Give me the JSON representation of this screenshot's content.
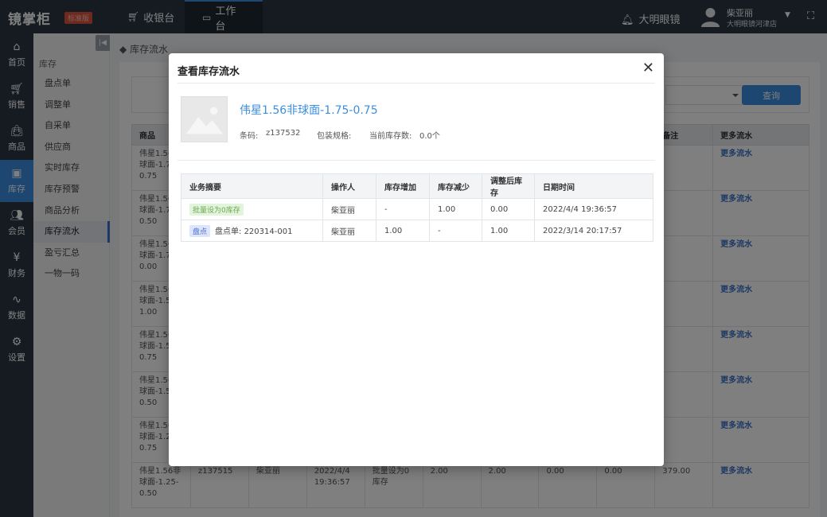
{
  "topbar": {
    "logo": "镜掌柜",
    "edition": "标准版",
    "nav": [
      {
        "label": "收银台",
        "icon": "cart-icon"
      },
      {
        "label": "工作台",
        "icon": "monitor-icon"
      }
    ],
    "store": "大明眼镜",
    "user_name": "柴亚丽",
    "user_store": "大明眼镜河津店"
  },
  "rail": {
    "items": [
      {
        "label": "首页",
        "icon": "home-icon"
      },
      {
        "label": "销售",
        "icon": "cart-icon"
      },
      {
        "label": "商品",
        "icon": "bag-icon"
      },
      {
        "label": "库存",
        "icon": "box-icon",
        "active": true
      },
      {
        "label": "会员",
        "icon": "members-icon"
      },
      {
        "label": "财务",
        "icon": "yen-icon"
      },
      {
        "label": "数据",
        "icon": "pulse-icon"
      },
      {
        "label": "设置",
        "icon": "gear-icon"
      }
    ]
  },
  "submenu": {
    "title": "库存",
    "items": [
      "盘点单",
      "调整单",
      "自采单",
      "供应商",
      "实时库存",
      "库存预警",
      "商品分析",
      "库存流水",
      "盈亏汇总",
      "一物一码"
    ],
    "active_index": 7
  },
  "page": {
    "breadcrumb": "库存流水",
    "query_label": "查询",
    "headers": [
      "商品",
      "",
      "",
      "",
      "",
      "",
      "",
      "",
      "",
      "备注",
      "更多流水"
    ],
    "more_label": "更多流水",
    "rows": [
      {
        "product": "伟星1.56非球面-1.75-0.75"
      },
      {
        "product": "伟星1.56非球面-1.75-0.50"
      },
      {
        "product": "伟星1.56非球面-1.75-0.00"
      },
      {
        "product": "伟星1.56非球面-1.50-1.00"
      },
      {
        "product": "伟星1.56非球面-1.50-0.75"
      },
      {
        "product": "伟星1.56非球面-1.50-0.50"
      },
      {
        "product": "伟星1.56非球面-1.25-0.75"
      },
      {
        "product": "伟星1.56非球面-1.25-0.50",
        "code": "z137515",
        "operator": "柴亚丽",
        "date": "2022/4/4 19:36:57",
        "summary": "批量设为0库存",
        "c1": "2.00",
        "c2": "2.00",
        "c3": "0.00",
        "c4": "0.00",
        "c5": "379.00"
      }
    ]
  },
  "modal": {
    "title": "查看库存流水",
    "product_name": "伟星1.56非球面-1.75-0.75",
    "barcode_label": "条码:",
    "barcode": "z137532",
    "pack_label": "包装规格:",
    "pack": "",
    "stock_label": "当前库存数:",
    "stock": "0.0个",
    "table": {
      "headers": [
        "业务摘要",
        "操作人",
        "库存增加",
        "库存减少",
        "调整后库存",
        "日期时间"
      ],
      "rows": [
        {
          "tag": "批量设为0库存",
          "tag_color": "green",
          "summary": "",
          "operator": "柴亚丽",
          "inc": "-",
          "dec": "1.00",
          "after": "0.00",
          "time": "2022/4/4 19:36:57"
        },
        {
          "tag": "盘点",
          "tag_color": "blue",
          "summary": "盘点单: 220314-001",
          "operator": "柴亚丽",
          "inc": "1.00",
          "dec": "-",
          "after": "1.00",
          "time": "2022/3/14 20:17:57"
        }
      ]
    }
  }
}
